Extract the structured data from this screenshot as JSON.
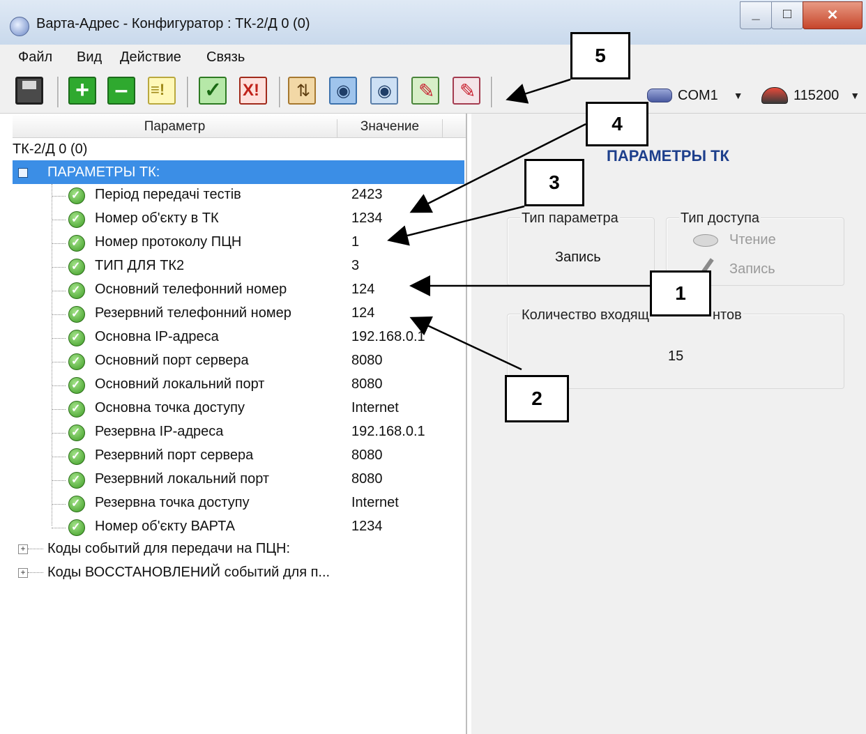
{
  "window": {
    "title": "Варта-Адрес - Конфигуратор : ТК-2/Д 0 (0)"
  },
  "menu": [
    "Файл",
    "Вид",
    "Действие",
    "Связь"
  ],
  "toolbar": {
    "port": "COM1",
    "baud": "115200"
  },
  "tree": {
    "header_param": "Параметр",
    "header_value": "Значение",
    "root": "ТК-2/Д 0 (0)",
    "section": "ПАРАМЕТРЫ ТК:",
    "rows": [
      {
        "name": "Період передачі тестів",
        "value": "2423"
      },
      {
        "name": "Номер об'єкту в ТК",
        "value": "1234"
      },
      {
        "name": "Номер протоколу ПЦН",
        "value": "1"
      },
      {
        "name": "ТИП ДЛЯ ТК2",
        "value": "3"
      },
      {
        "name": "Основний телефонний номер",
        "value": "124"
      },
      {
        "name": "Резервний телефонний номер",
        "value": "124"
      },
      {
        "name": "Основна IP-адреса",
        "value": "192.168.0.1"
      },
      {
        "name": "Основний порт сервера",
        "value": "8080"
      },
      {
        "name": "Основний локальний порт",
        "value": "8080"
      },
      {
        "name": "Основна точка доступу",
        "value": "Internet"
      },
      {
        "name": "Резервна IP-адреса",
        "value": "192.168.0.1"
      },
      {
        "name": "Резервний порт сервера",
        "value": "8080"
      },
      {
        "name": "Резервний локальний порт",
        "value": "8080"
      },
      {
        "name": "Резервна точка доступу",
        "value": "Internet"
      },
      {
        "name": "Номер об'єкту ВАРТА",
        "value": "1234"
      }
    ],
    "groups": [
      "Коды событий для передачи на ПЦН:",
      "Коды ВОССТАНОВЛЕНИЙ событий для п..."
    ]
  },
  "details": {
    "title": "ПАРАМЕТРЫ ТК",
    "param_type_label": "Тип параметра",
    "param_type_value": "Запись",
    "access_label": "Тип доступа",
    "access_read": "Чтение",
    "access_write": "Запись",
    "count_label_left": "Количество входящ",
    "count_label_right": "нтов",
    "count_value": "15"
  },
  "callouts": [
    "5",
    "4",
    "3",
    "1",
    "2"
  ]
}
